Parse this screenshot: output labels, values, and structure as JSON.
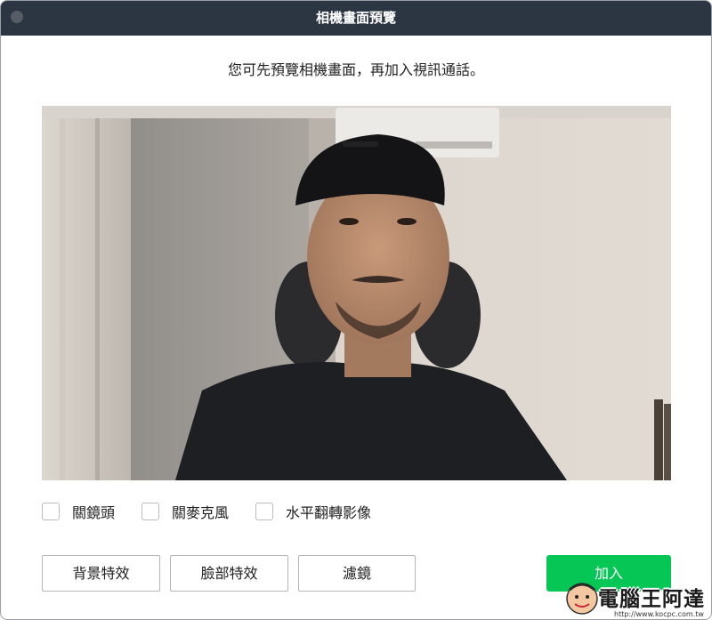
{
  "window": {
    "title": "相機畫面預覽"
  },
  "dialog": {
    "instruction": "您可先預覽相機畫面，再加入視訊通話。",
    "options": [
      {
        "label": "關鏡頭",
        "checked": false
      },
      {
        "label": "關麥克風",
        "checked": false
      },
      {
        "label": "水平翻轉影像",
        "checked": false
      }
    ],
    "buttons": {
      "background_effects": "背景特效",
      "face_effects": "臉部特效",
      "filters": "濾鏡",
      "join": "加入"
    }
  },
  "colors": {
    "titlebar": "#2c3542",
    "join_button": "#06c755",
    "border": "#b3b6bb"
  },
  "watermark": {
    "text": "電腦王阿達",
    "url": "http://www.kocpc.com.tw"
  }
}
